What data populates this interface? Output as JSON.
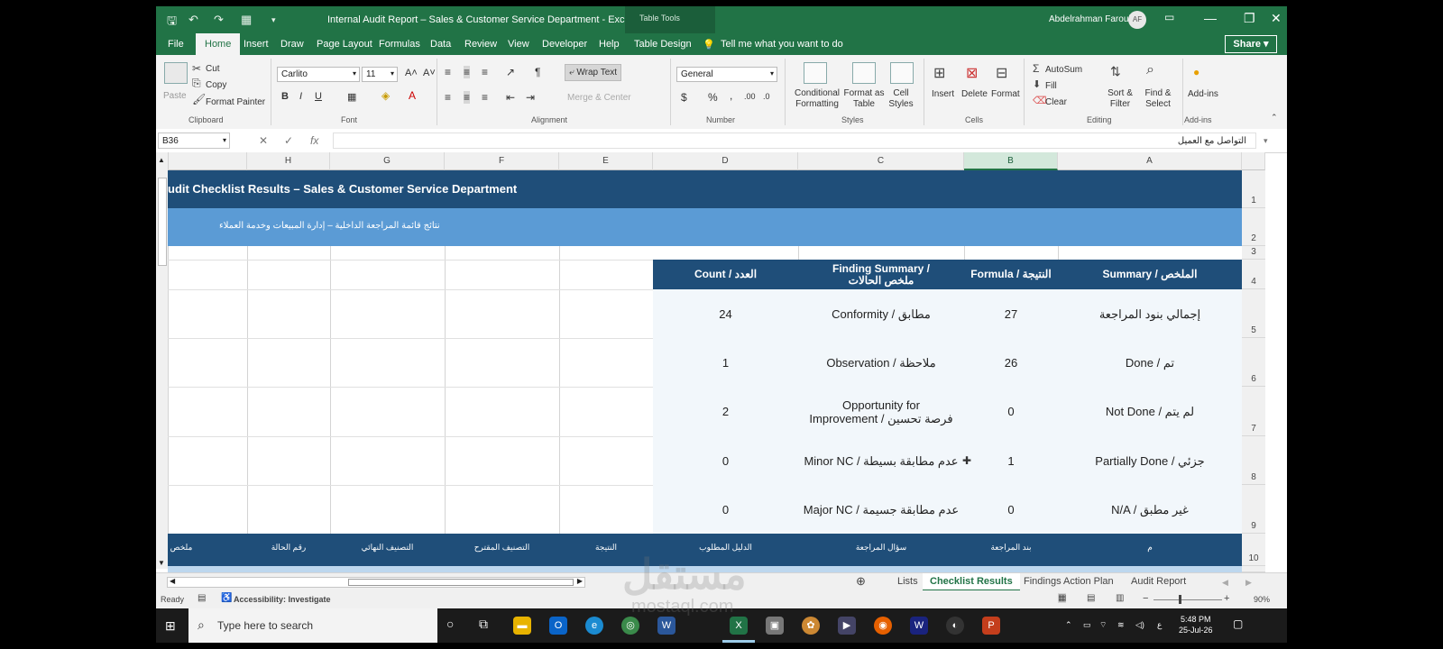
{
  "titlebar": {
    "title": "Internal Audit Report – Sales & Customer Service Department  -  Excel",
    "table_tools": "Table Tools",
    "user": "Abdelrahman Farouk",
    "initials": "AF"
  },
  "ribbon_tabs": [
    "File",
    "Home",
    "Insert",
    "Draw",
    "Page Layout",
    "Formulas",
    "Data",
    "Review",
    "View",
    "Developer",
    "Help",
    "Table Design"
  ],
  "tell_me": "Tell me what you want to do",
  "share": "Share",
  "ribbon": {
    "paste": "Paste",
    "cut": "Cut",
    "copy": "Copy",
    "format_painter": "Format Painter",
    "clipboard": "Clipboard",
    "font_name": "Carlito",
    "font_size": "11",
    "font": "Font",
    "wrap_text": "Wrap Text",
    "merge_center": "Merge & Center",
    "alignment": "Alignment",
    "number_format": "General",
    "number": "Number",
    "conditional_formatting": "Conditional Formatting",
    "format_as_table": "Format as Table",
    "cell_styles": "Cell Styles",
    "styles": "Styles",
    "insert": "Insert",
    "delete": "Delete",
    "format": "Format",
    "cells": "Cells",
    "autosum": "AutoSum",
    "fill": "Fill",
    "clear": "Clear",
    "sort_filter": "Sort & Filter",
    "find_select": "Find & Select",
    "editing": "Editing",
    "addins": "Add-ins",
    "addins_group": "Add-ins"
  },
  "formula_bar": {
    "name_box": "B36",
    "value": "التواصل مع العميل"
  },
  "columns": [
    "H",
    "G",
    "F",
    "E",
    "D",
    "C",
    "B",
    "A"
  ],
  "rows": [
    "1",
    "2",
    "3",
    "4",
    "5",
    "6",
    "7",
    "8",
    "9",
    "10"
  ],
  "sheet": {
    "title_en": "udit Checklist Results – Sales & Customer Service Department",
    "title_ar": "نتائج قائمة المراجعة الداخلية – إدارة المبيعات وخدمة العملاء",
    "summary_headers": {
      "count": "Count / العدد",
      "finding_summary": "Finding Summary / ملخص الحالات",
      "formula": "Formula / النتيجة",
      "summary": "Summary / الملخص"
    },
    "summary_rows": [
      {
        "count": "24",
        "finding": "Conformity / مطابق",
        "formula": "27",
        "summary": "إجمالي بنود المراجعة"
      },
      {
        "count": "1",
        "finding": "Observation / ملاحظة",
        "formula": "26",
        "summary": "Done / تم"
      },
      {
        "count": "2",
        "finding": "Opportunity for Improvement / فرصة تحسين",
        "formula": "0",
        "summary": "Not Done / لم يتم"
      },
      {
        "count": "0",
        "finding": "Minor NC / عدم مطابقة بسيطة",
        "formula": "1",
        "summary": "Partially Done / جزئي"
      },
      {
        "count": "0",
        "finding": "Major NC / عدم مطابقة جسيمة",
        "formula": "0",
        "summary": "N/A / غير مطبق"
      }
    ],
    "checklist_headers": [
      "ملخص",
      "رقم الحالة",
      "التصنيف النهائي",
      "التصنيف المقترح",
      "النتيجة",
      "الدليل المطلوب",
      "سؤال المراجعة",
      "بند المراجعة",
      "م"
    ]
  },
  "sheet_tabs": [
    "Lists",
    "Checklist Results",
    "Findings Action Plan",
    "Audit Report"
  ],
  "status": {
    "ready": "Ready",
    "accessibility": "Accessibility: Investigate",
    "zoom": "90%"
  },
  "taskbar": {
    "search_placeholder": "Type here to search",
    "lang": "ع",
    "time": "5:48 PM",
    "date": "25-Jul-26"
  },
  "watermark": {
    "ar": "مستقل",
    "en": "mostaql.com"
  }
}
